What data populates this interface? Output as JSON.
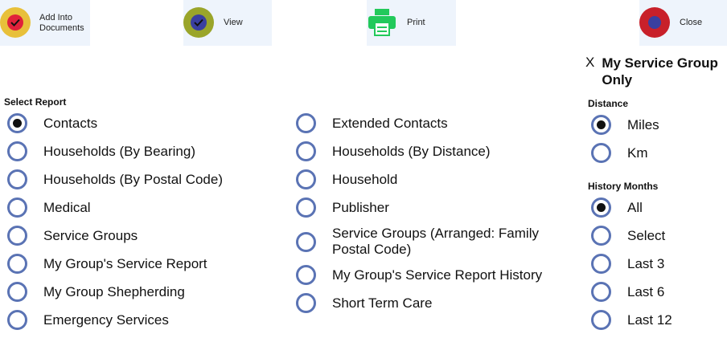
{
  "toolbar": {
    "add": {
      "label_line1": "Add Into",
      "label_line2": "Documents",
      "icon": "checkmark-icon",
      "color": "#e8c03a",
      "inner_color": "#e0213a"
    },
    "view": {
      "label": "View",
      "icon": "checkmark-icon",
      "color": "#9aa52a",
      "inner_color": "#3a3fa0"
    },
    "print": {
      "label": "Print",
      "icon": "printer-icon",
      "color": "#22c95b"
    },
    "close": {
      "label": "Close",
      "icon": "close-icon",
      "color": "#c8202a",
      "inner_color": "#3a3fa0"
    }
  },
  "my_service_group": {
    "x_label": "X",
    "label": "My Service Group Only"
  },
  "select_report": {
    "label": "Select Report",
    "selected": "Contacts",
    "left_options": [
      "Contacts",
      "Households (By Bearing)",
      "Households (By Postal Code)",
      "Medical",
      "Service Groups",
      "My Group's Service Report",
      "My Group Shepherding",
      "Emergency Services"
    ],
    "right_options": [
      "Extended Contacts",
      "Households (By Distance)",
      "Household",
      "Publisher",
      "Service Groups (Arranged: Family Postal Code)",
      "My Group's Service Report History",
      "Short Term Care"
    ]
  },
  "distance": {
    "label": "Distance",
    "selected": "Miles",
    "options": [
      "Miles",
      "Km"
    ]
  },
  "history_months": {
    "label": "History Months",
    "selected": "All",
    "options": [
      "All",
      "Select",
      "Last 3",
      "Last 6",
      "Last 12"
    ]
  },
  "colors": {
    "radio_border": "#5a73b4",
    "toolbar_bg": "#eef4fc"
  }
}
